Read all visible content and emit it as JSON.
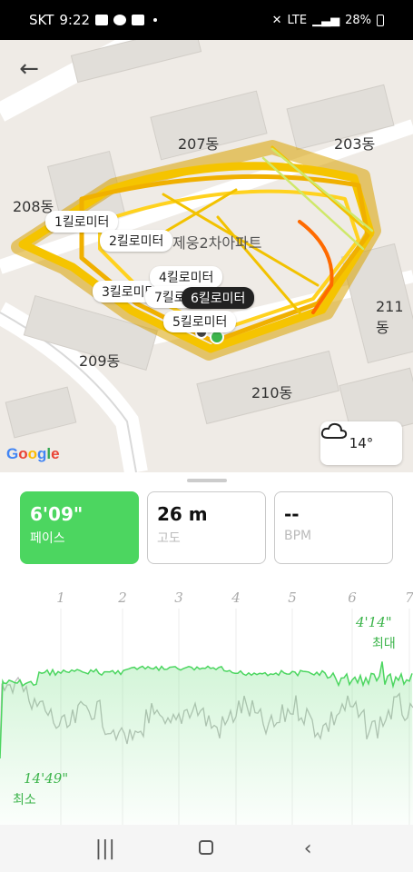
{
  "status_bar": {
    "carrier": "SKT",
    "time": "9:22",
    "network": "LTE",
    "battery": "28%"
  },
  "map": {
    "buildings": [
      "207동",
      "203동",
      "208동",
      "209동",
      "210동",
      "211동"
    ],
    "landmark": "제웅2차아파트",
    "km_markers": [
      "1킬로미터",
      "2킬로미터",
      "3킬로미터",
      "4킬로미터",
      "5킬로미터",
      "6킬로미터",
      "7킬로미터"
    ],
    "provider": "Google",
    "weather": {
      "temp": "14°",
      "icon": "cloud-icon"
    },
    "route_color": "#f5c400"
  },
  "metrics": [
    {
      "value": "6'09\"",
      "label": "페이스",
      "active": true
    },
    {
      "value": "26 m",
      "label": "고도",
      "active": false
    },
    {
      "value": "--",
      "label": "BPM",
      "active": false
    }
  ],
  "chart_data": {
    "type": "line",
    "x_ticks": [
      "1",
      "2",
      "3",
      "4",
      "5",
      "6",
      "7"
    ],
    "annotations": {
      "max_value": "4'14\"",
      "max_label": "최대",
      "min_value": "14'49\"",
      "min_label": "최소"
    },
    "series": [
      {
        "color": "#4cd660"
      },
      {
        "color": "#bfbfbf"
      }
    ]
  }
}
